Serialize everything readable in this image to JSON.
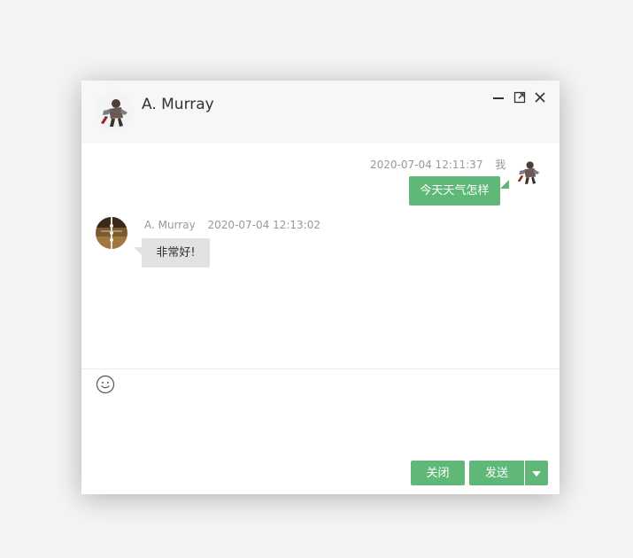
{
  "header": {
    "title": "A. Murray"
  },
  "window_controls": {
    "minimize_icon": "minimize-icon",
    "maximize_icon": "maximize-icon",
    "close_icon": "close-icon"
  },
  "messages": [
    {
      "from": "me",
      "timestamp": "2020-07-04 12:11:37",
      "sender_label": "我",
      "text": "今天天气怎样"
    },
    {
      "from": "other",
      "sender_label": "A. Murray",
      "timestamp": "2020-07-04 12:13:02",
      "text": "非常好!"
    }
  ],
  "toolbar": {
    "emoji_icon": "smiley-icon"
  },
  "input": {
    "value": "",
    "placeholder": ""
  },
  "buttons": {
    "close_label": "关闭",
    "send_label": "发送",
    "send_options_icon": "caret-down-icon"
  },
  "colors": {
    "accent": "#5fb878",
    "bubble_other": "#e2e2e2",
    "header_bg": "#f7f7f7",
    "page_bg": "#f4f4f4"
  }
}
